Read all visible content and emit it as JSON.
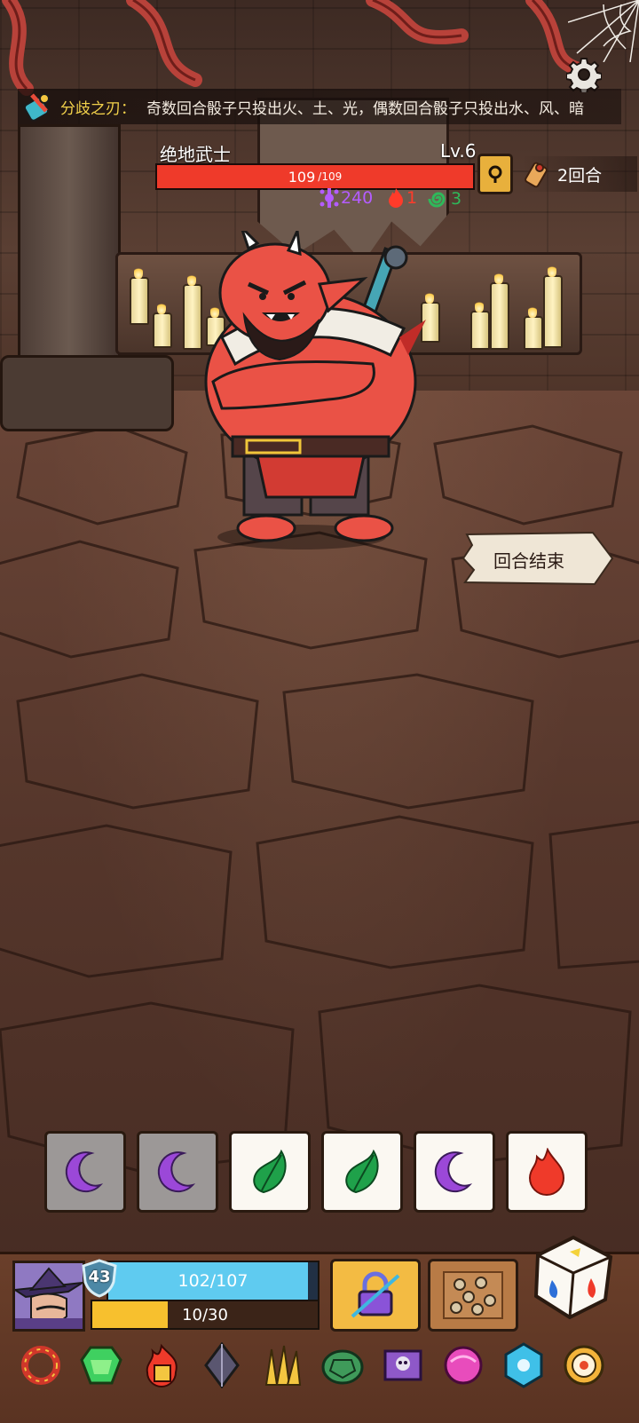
{
  "buff": {
    "icon": "blade-icon",
    "name": "分歧之刃：",
    "description": "奇数回合骰子只投出火、土、光，偶数回合骰子只投出水、风、暗"
  },
  "enemy": {
    "name": "绝地武士",
    "level": "Lv.6",
    "hp_current": "109",
    "hp_max": "/109",
    "hp_ratio": 1.0,
    "stats": {
      "attack": "240",
      "fire": "1",
      "swirl": "3"
    }
  },
  "turn": {
    "label": "2回合"
  },
  "end_turn": {
    "label": "回合结束"
  },
  "dice": [
    {
      "symbol": "moon",
      "state": "used"
    },
    {
      "symbol": "moon",
      "state": "used"
    },
    {
      "symbol": "leaf",
      "state": "fresh"
    },
    {
      "symbol": "leaf",
      "state": "fresh"
    },
    {
      "symbol": "moon",
      "state": "fresh"
    },
    {
      "symbol": "fire",
      "state": "fresh"
    }
  ],
  "player": {
    "shield": "43",
    "hp": "102/107",
    "hp_ratio": 0.953,
    "xp": "10/30",
    "xp_ratio": 0.333
  },
  "items": [
    "spiked-ring",
    "emerald-gem",
    "fire-scroll",
    "dark-crystal",
    "golden-claws",
    "turtle-shell",
    "skull-book",
    "pink-orb",
    "ice-crystal",
    "spiral-donut"
  ],
  "colors": {
    "enemy_hp": "#ef3a2a",
    "player_hp": "#5fcbf0",
    "player_xp": "#f7c02e",
    "buff_name": "#f3d24b",
    "stat_attack": "#b45cff",
    "stat_fire": "#ff3b2a",
    "stat_swirl": "#2fb85a"
  }
}
